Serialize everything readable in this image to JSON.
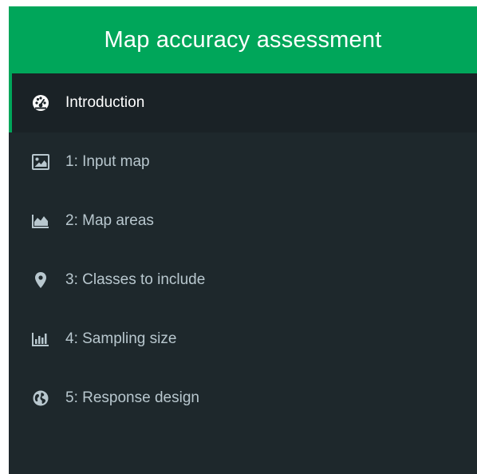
{
  "header": {
    "title": "Map accuracy assessment"
  },
  "sidebar": {
    "active_index": 0,
    "items": [
      {
        "label": "Introduction",
        "icon": "dashboard-icon"
      },
      {
        "label": "1: Input map",
        "icon": "picture-icon"
      },
      {
        "label": "2: Map areas",
        "icon": "area-chart-icon"
      },
      {
        "label": "3: Classes to include",
        "icon": "map-marker-icon"
      },
      {
        "label": "4: Sampling size",
        "icon": "bar-chart-icon"
      },
      {
        "label": "5: Response design",
        "icon": "globe-icon"
      }
    ]
  },
  "colors": {
    "header_bg": "#00a65a",
    "sidebar_bg": "#1e282c",
    "active_bg": "#1a2226",
    "active_border": "#00a65a",
    "text": "#b8c7ce",
    "active_text": "#ffffff"
  }
}
